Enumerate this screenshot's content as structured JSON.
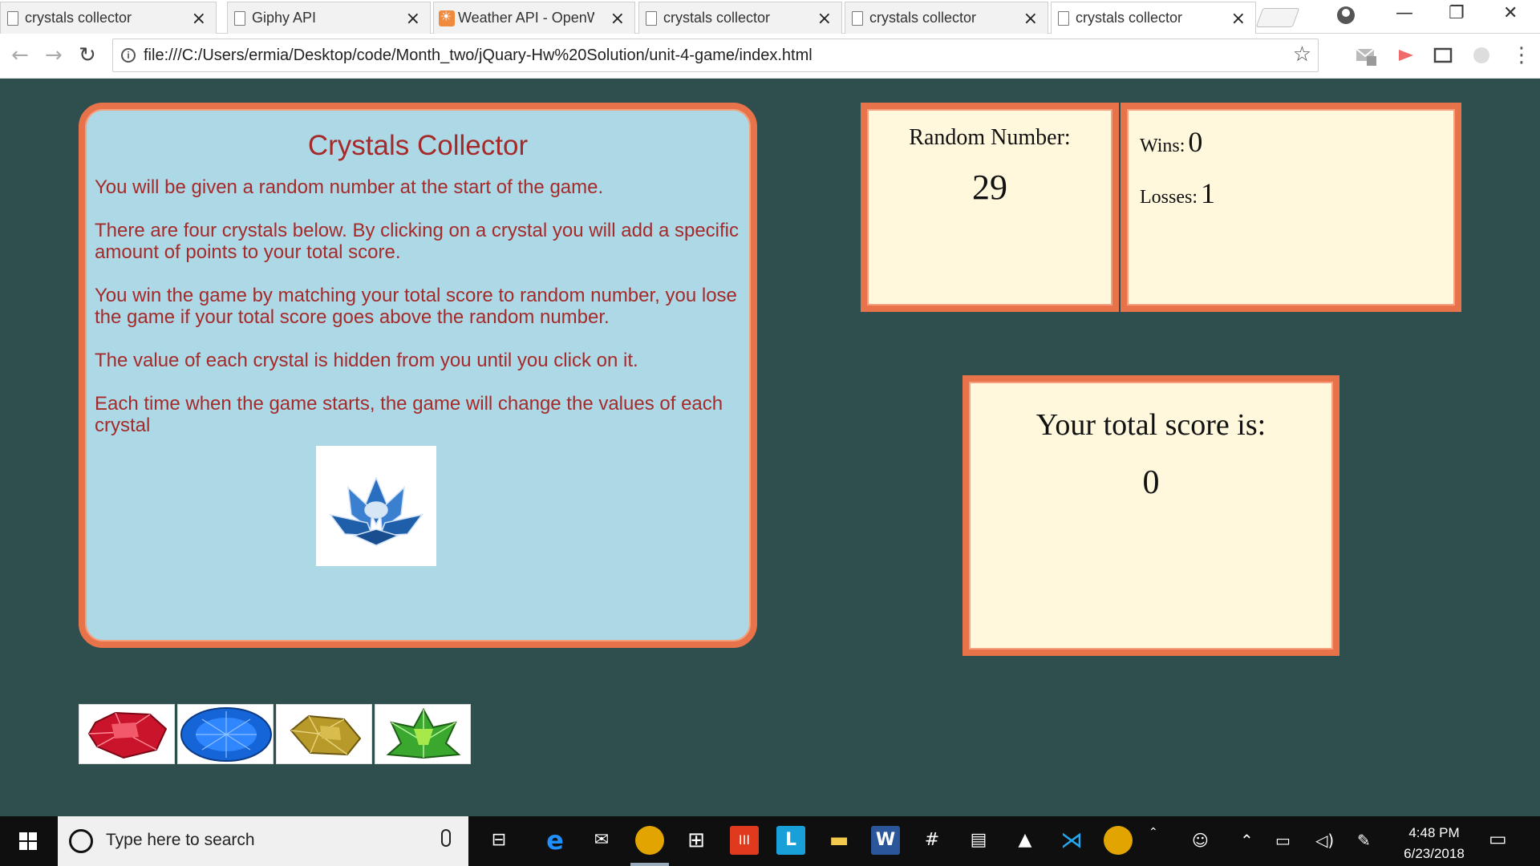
{
  "browser": {
    "tabs": [
      {
        "title": "crystals collector",
        "favicon": "page-icon"
      },
      {
        "title": "Giphy API",
        "favicon": "page-icon"
      },
      {
        "title": "Weather API - OpenW",
        "favicon": "weather-favicon"
      },
      {
        "title": "crystals collector",
        "favicon": "page-icon"
      },
      {
        "title": "crystals collector",
        "favicon": "page-icon"
      },
      {
        "title": "crystals collector",
        "favicon": "page-icon",
        "active": true
      }
    ],
    "url": "file:///C:/Users/ermia/Desktop/code/Month_two/jQuary-Hw%20Solution/unit-4-game/index.html"
  },
  "game": {
    "title": "Crystals Collector",
    "rules": [
      "You will be given a random number at the start of the game.",
      "There are four crystals below. By clicking on a crystal you will add a specific amount of points to your total score.",
      "You win the game by matching your total score to random number, you lose the game if your total score goes above the random number.",
      "The value of each crystal is hidden from you until you click on it.",
      "Each time when the game starts, the game will change the values of each crystal"
    ],
    "random_label": "Random Number:",
    "random_value": "29",
    "wins_label": "Wins:",
    "wins_value": "0",
    "losses_label": "Losses:",
    "losses_value": "1",
    "score_label": "Your total score is:",
    "score_value": "0",
    "crystals": [
      "red-crystal",
      "blue-crystal",
      "yellow-crystal",
      "green-crystal"
    ]
  },
  "taskbar": {
    "search_placeholder": "Type here to search",
    "time": "4:48 PM",
    "date": "6/23/2018"
  },
  "colors": {
    "page_bg": "#2f4f4f",
    "panel_border": "#e8734a",
    "info_bg": "#add8e6",
    "panel_bg": "#fff8dc",
    "rule_text": "#a52a2a"
  }
}
